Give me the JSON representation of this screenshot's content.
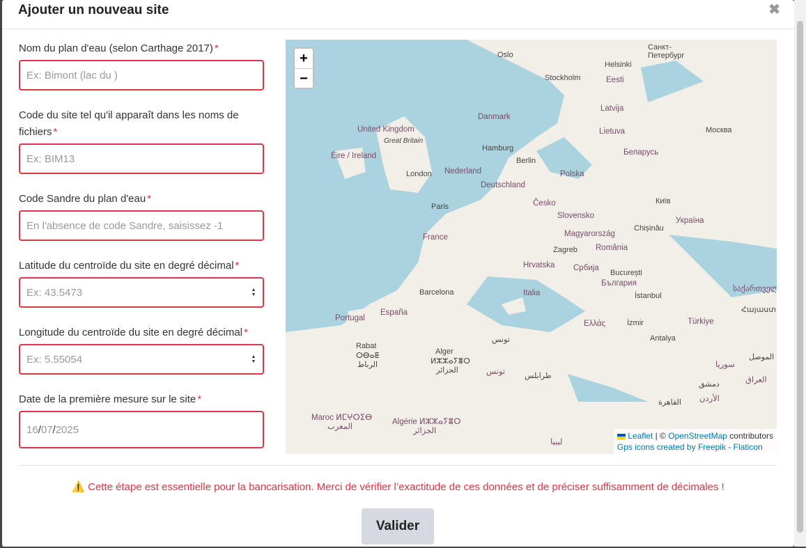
{
  "modal": {
    "title": "Ajouter un nouveau site",
    "close_icon": "close-icon"
  },
  "form": {
    "required_mark": "*",
    "fields": [
      {
        "label": "Nom du plan d'eau (selon Carthage 2017)",
        "placeholder": "Ex: Bimont (lac du )"
      },
      {
        "label": "Code du site tel qu'il apparaît dans les noms de fichiers",
        "placeholder": "Ex: BIM13"
      },
      {
        "label": "Code Sandre du plan d'eau",
        "placeholder": "En l'absence de code Sandre, saisissez -1"
      },
      {
        "label": "Latitude du centroïde du site en degré décimal",
        "placeholder": "Ex: 43.5473"
      },
      {
        "label": "Longitude du centroïde du site en degré décimal",
        "placeholder": "Ex: 5.55054"
      },
      {
        "label": "Date de la première mesure sur le site",
        "value": {
          "day": "16",
          "month": "07",
          "year": "2025",
          "sep": "/"
        }
      }
    ]
  },
  "map": {
    "zoom_in": "+",
    "zoom_out": "−",
    "attribution": {
      "leaflet": "Leaflet",
      "sep": "| ©",
      "osm": "OpenStreetMap",
      "contributors": "contributors",
      "gps_prefix": "Gps icons created by",
      "freepik": "Freepik",
      "dash": "-",
      "flaticon": "Flaticon"
    },
    "labels": {
      "oslo": "Oslo",
      "stockholm": "Stockholm",
      "helsinki": "Helsinki",
      "spb": "Санкт-Петербург",
      "eesti": "Eesti",
      "latvija": "Latvija",
      "lietuva": "Lietuva",
      "moskva": "Москва",
      "danmark": "Danmark",
      "uk": "United Kingdom",
      "gb": "Great Britain",
      "eire": "Éire / Ireland",
      "hamburg": "Hamburg",
      "berlin": "Berlin",
      "belarus": "Беларусь",
      "london": "London",
      "nederland": "Nederland",
      "deutschland": "Deutschland",
      "polska": "Polska",
      "kyiv": "Київ",
      "paris": "Paris",
      "cesko": "Česko",
      "slovensko": "Slovensko",
      "ukraina": "Україна",
      "france": "France",
      "magyar": "Magyarország",
      "chisinau": "Chișinău",
      "zagreb": "Zagreb",
      "romania": "România",
      "hrvatska": "Hrvatska",
      "srbija": "Србија",
      "bucuresti": "București",
      "bulgaria": "България",
      "barcelona": "Barcelona",
      "italia": "Italia",
      "istanbul": "İstanbul",
      "georgia": "საქართველო",
      "portugal": "Portugal",
      "espana": "España",
      "ellas": "Ελλάς",
      "izmir": "İzmir",
      "turkiye": "Türkiye",
      "armenia": "Հայաստան",
      "antalya": "Antalya",
      "tunis": "تونس",
      "rabat": "Rabat",
      "rabat2": "ⵔⴱⴰⵟ",
      "rabat3": "الرباط",
      "alger": "Alger",
      "alger2": "ⵍⵣⵣⴰⵢⴻⵔ",
      "alger3": "الجزائر",
      "tunis2": "تونس",
      "syria": "سوريا",
      "mosul": "الموصل",
      "iraq": "العراق",
      "damascus": "دمشق",
      "tripoli": "طرابلس",
      "jordan": "الأردن",
      "maroc": "Maroc ⵍⵎⵖⵔⵉⴱ",
      "maroc2": "المغرب",
      "algerie": "Algérie ⵍⵣⵣⴰⵢⴻⵔ",
      "algerie2": "الجزائر",
      "cairo": "القاهرة",
      "libya": "ليبيا"
    }
  },
  "footer": {
    "warning_icon": "warning-icon",
    "warning_glyph": "⚠️",
    "warning": "Cette étape est essentielle pour la bancarisation. Merci de vérifier l’exactitude de ces données et de préciser suffisamment de décimales !",
    "submit": "Valider"
  }
}
